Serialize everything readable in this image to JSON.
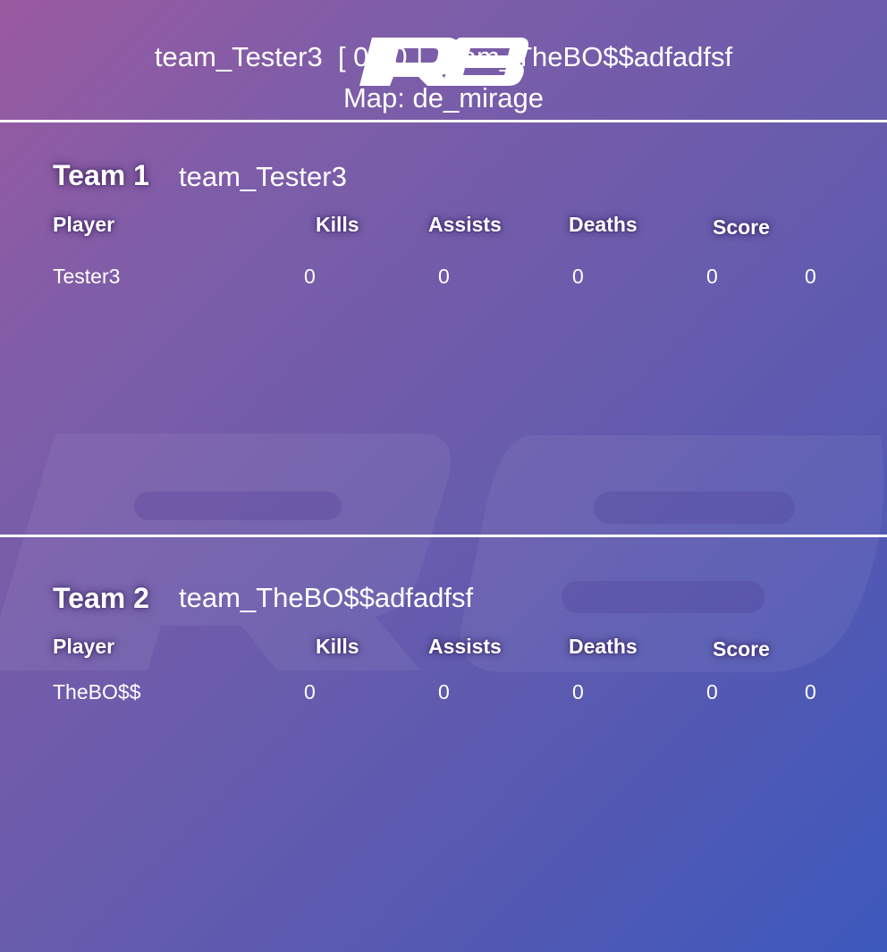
{
  "header": {
    "match_title": "team_Tester3  [ 0 : 0 ]  team_TheBO$$adfadfsf",
    "map_label": "Map: de_mirage",
    "logo_name": "r8-logo"
  },
  "columns": [
    "Player",
    "Kills",
    "Assists",
    "Deaths",
    "Score"
  ],
  "teams": [
    {
      "heading": "Team 1",
      "name": "team_Tester3",
      "players": [
        {
          "name": "Tester3",
          "kills": "0",
          "assists": "0",
          "deaths": "0",
          "score": "0",
          "extra": "0"
        }
      ]
    },
    {
      "heading": "Team 2",
      "name": "team_TheBO$$adfadfsf",
      "players": [
        {
          "name": "TheBO$$",
          "kills": "0",
          "assists": "0",
          "deaths": "0",
          "score": "0",
          "extra": "0"
        }
      ]
    }
  ]
}
